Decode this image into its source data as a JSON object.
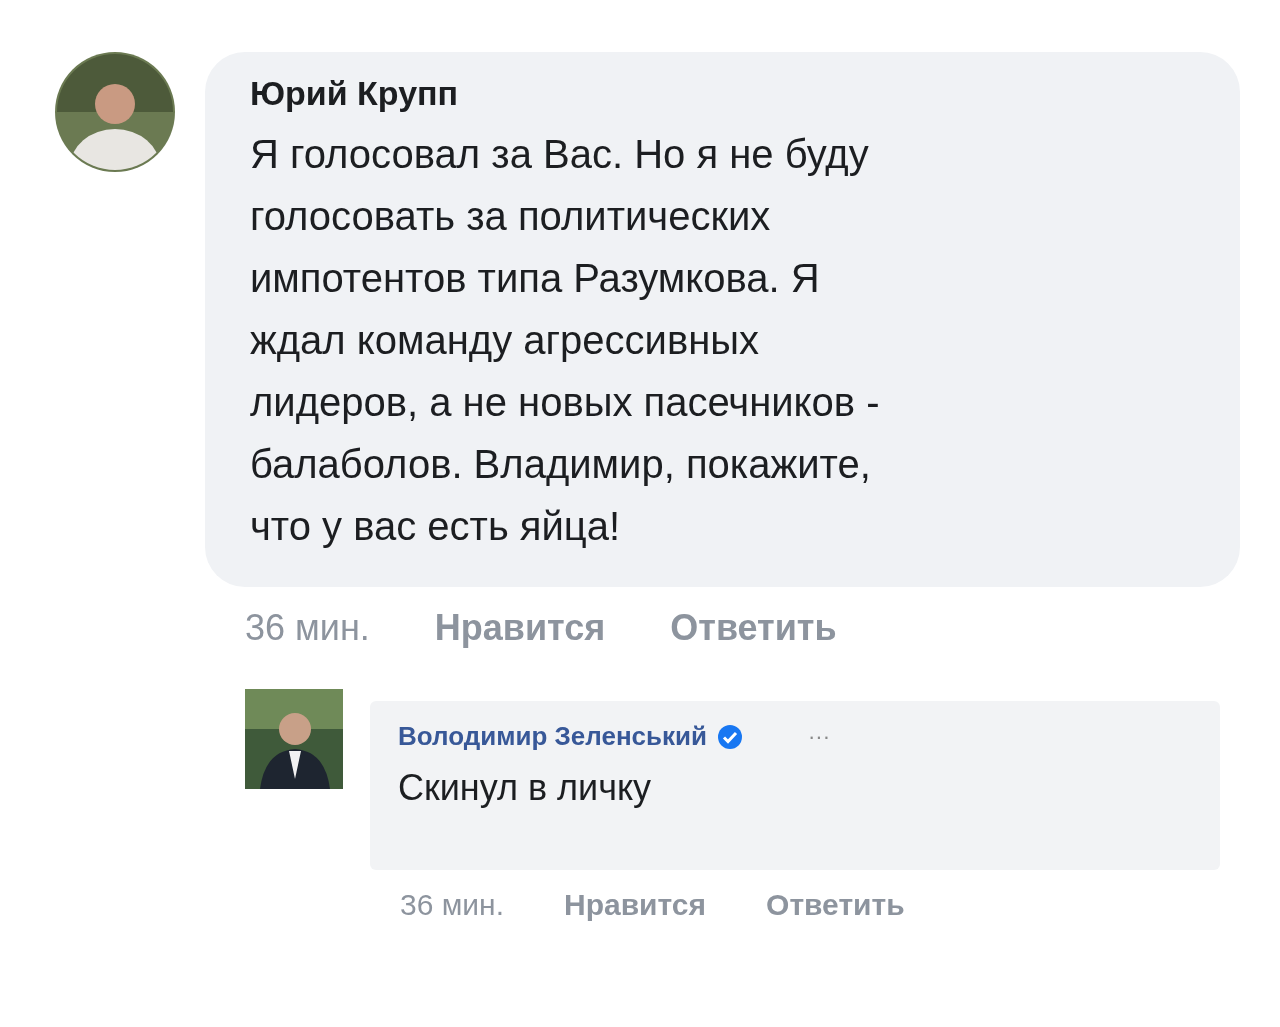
{
  "comments": [
    {
      "author": "Юрий Крупп",
      "kind": "comment",
      "verified": false,
      "text": "Я голосовал за Вас. Но я не буду\nголосовать за политических\nимпотентов типа Разумкова. Я\nждал команду агрессивных\nлидеров, а не новых пасечников -\nбалаболов. Владимир, покажите,\nчто у вас есть яйца!",
      "time": "36 мин.",
      "like": "Нравится",
      "reply": "Ответить"
    },
    {
      "author": "Володимир Зеленський",
      "kind": "reply",
      "verified": true,
      "more": "···",
      "text": "Скинул в личку",
      "time": "36 мин.",
      "like": "Нравится",
      "reply": "Ответить"
    }
  ]
}
